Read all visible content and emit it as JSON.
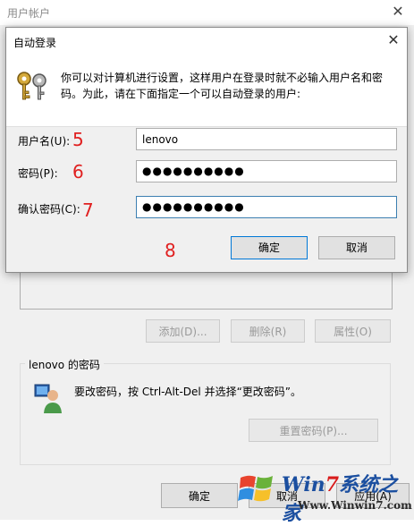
{
  "background_window": {
    "title": "用户帐户",
    "close_glyph": "✕",
    "buttons": {
      "add": "添加(D)...",
      "remove": "删除(R)",
      "properties": "属性(O)"
    },
    "password_group": {
      "label": "lenovo 的密码",
      "info": "要改密码，按 Ctrl-Alt-Del 并选择“更改密码”。",
      "reset_button": "重置密码(P)..."
    },
    "footer": {
      "ok": "确定",
      "cancel": "取消",
      "apply": "应用(A)"
    }
  },
  "dialog": {
    "title": "自动登录",
    "close_glyph": "✕",
    "description": "你可以对计算机进行设置，这样用户在登录时就不必输入用户名和密码。为此，请在下面指定一个可以自动登录的用户:",
    "fields": {
      "username": {
        "label": "用户名(U):",
        "value": "lenovo"
      },
      "password": {
        "label": "密码(P):",
        "value": "●●●●●●●●●●"
      },
      "confirm": {
        "label": "确认密码(C):",
        "value": "●●●●●●●●●●"
      }
    },
    "buttons": {
      "ok": "确定",
      "cancel": "取消"
    }
  },
  "annotations": {
    "step5": "5",
    "step6": "6",
    "step7": "7",
    "step8": "8"
  },
  "watermark": {
    "brand_prefix": "Win",
    "brand_seven": "7",
    "brand_suffix": "系统之家",
    "url": "Www.Winwin7.com"
  },
  "colors": {
    "annotation_red": "#e02020",
    "focus_blue": "#0078d7",
    "watermark_blue": "#1b4fa0"
  },
  "icons": {
    "dialog": "keys-icon",
    "group": "user-icon",
    "watermark": "windows-flag-icon"
  }
}
